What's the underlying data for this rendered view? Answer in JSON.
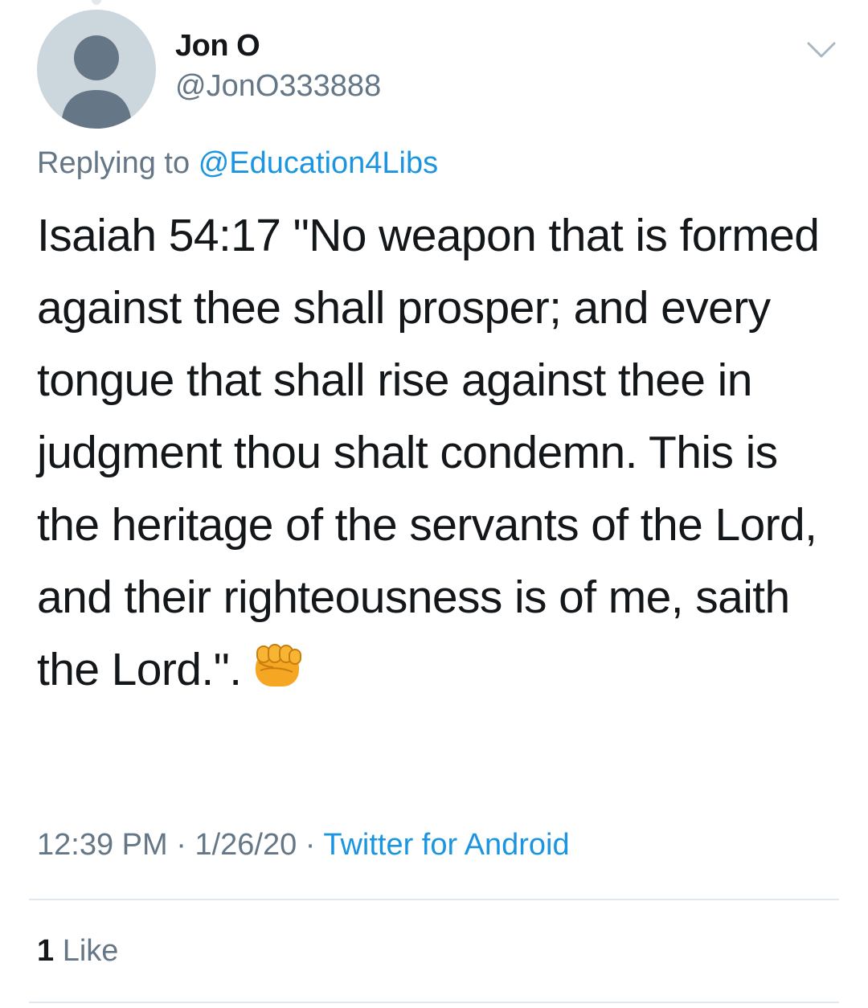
{
  "author": {
    "display_name": "Jon O",
    "handle": "@JonO333888",
    "avatar_icon": "default-profile-silhouette-icon"
  },
  "header": {
    "menu_icon": "chevron-down-icon"
  },
  "reply": {
    "prefix": "Replying to",
    "mention": "@Education4Libs"
  },
  "tweet": {
    "text": "Isaiah 54:17 \"No weapon that is formed against thee shall prosper; and every tongue that shall rise against thee in judgment thou shalt condemn. This is the heritage of the servants of the Lord, and their righteousness is of me, saith the Lord.\".",
    "emoji_icon": "oncoming-fist-icon"
  },
  "meta": {
    "time": "12:39 PM",
    "separator": "·",
    "date": "1/26/20",
    "source": "Twitter for Android"
  },
  "stats": {
    "like_count": "1",
    "like_label": "Like"
  },
  "colors": {
    "link": "#1b95e0",
    "secondary_text": "#657786",
    "primary_text": "#14171a",
    "divider": "#e1e8ed",
    "avatar_bg": "#ccd6dd",
    "avatar_figure": "#657786"
  }
}
